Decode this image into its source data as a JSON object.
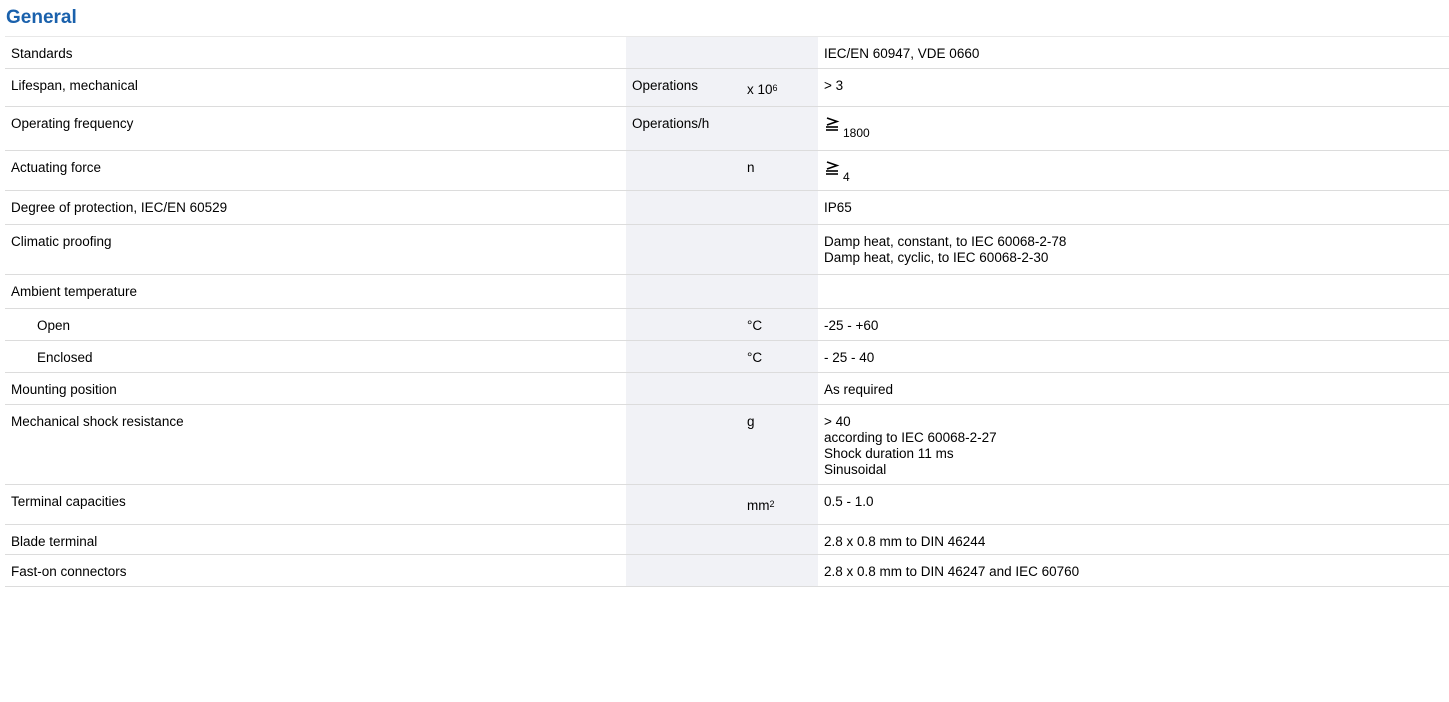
{
  "section_title": "General",
  "rows": [
    {
      "label": "Standards",
      "unit": "",
      "mult": "",
      "value": [
        "IEC/EN 60947, VDE 0660"
      ]
    },
    {
      "label": "Lifespan, mechanical",
      "unit": "Operations",
      "mult_base": "x 10",
      "mult_sup": "6",
      "value": [
        "> 3"
      ]
    },
    {
      "label": "Operating frequency",
      "unit": "Operations/h",
      "mult": "",
      "value_sym": "less-or-equal-icon",
      "value_sub": "1800"
    },
    {
      "label": "Actuating force",
      "unit": "",
      "mult": "n",
      "value_sym": "less-or-equal-icon",
      "value_sub": "4"
    },
    {
      "label": "Degree of protection, IEC/EN 60529",
      "unit": "",
      "mult": "",
      "value": [
        "IP65"
      ]
    },
    {
      "label": "Climatic proofing",
      "unit": "",
      "mult": "",
      "value": [
        "Damp heat, constant, to IEC 60068-2-78",
        "Damp heat, cyclic, to IEC 60068-2-30"
      ]
    },
    {
      "label": "Ambient temperature",
      "unit": "",
      "mult": "",
      "value": [
        ""
      ]
    },
    {
      "label": "Open",
      "indent": true,
      "unit": "",
      "mult": "°C",
      "value": [
        "-25 - +60"
      ]
    },
    {
      "label": "Enclosed",
      "indent": true,
      "unit": "",
      "mult": "°C",
      "value": [
        "- 25 - 40"
      ]
    },
    {
      "label": "Mounting position",
      "unit": "",
      "mult": "",
      "value": [
        "As required"
      ]
    },
    {
      "label": "Mechanical shock resistance",
      "unit": "",
      "mult": "g",
      "value": [
        "> 40",
        "according to IEC 60068-2-27",
        "Shock duration 11 ms",
        "Sinusoidal"
      ]
    },
    {
      "label": "Terminal capacities",
      "unit": "",
      "mult_base": "mm",
      "mult_sup": "2",
      "value": [
        "0.5 - 1.0"
      ]
    },
    {
      "label": "Blade terminal",
      "unit": "",
      "mult": "",
      "value": [
        "2.8 x 0.8 mm to DIN 46244"
      ]
    },
    {
      "label": "Fast-on connectors",
      "unit": "",
      "mult": "",
      "value": [
        "2.8 x 0.8 mm to DIN 46247 and IEC 60760"
      ]
    }
  ],
  "colors": {
    "title": "#1a61ac",
    "shaded_cells": "#f1f2f6",
    "rule": "#dcdcdc"
  }
}
